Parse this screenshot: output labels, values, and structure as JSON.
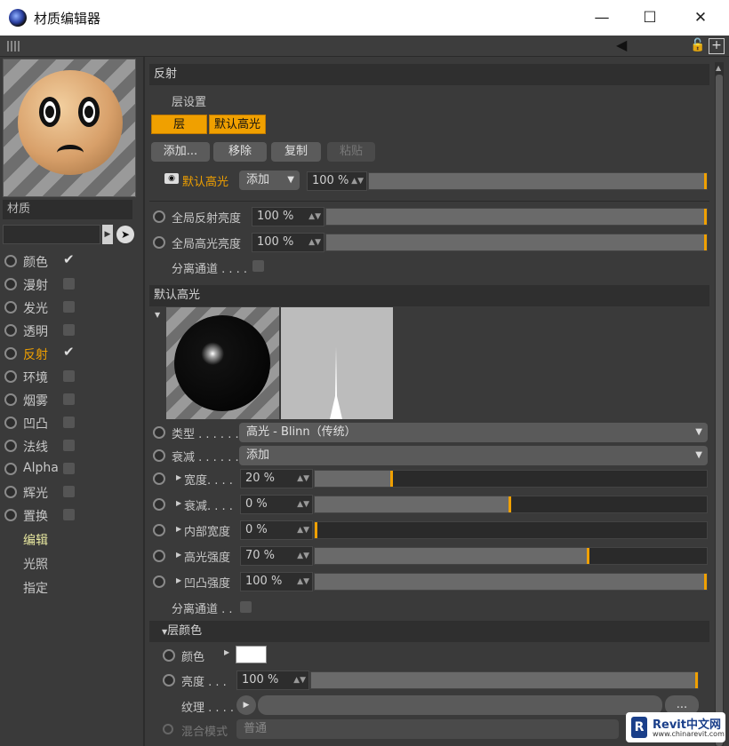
{
  "window": {
    "title": "材质编辑器",
    "minimize": "—",
    "maximize": "☐",
    "close": "✕"
  },
  "left": {
    "material_label": "材质",
    "channels": [
      {
        "label": "颜色",
        "checked": true,
        "active": false
      },
      {
        "label": "漫射",
        "checked": false,
        "active": false
      },
      {
        "label": "发光",
        "checked": false,
        "active": false
      },
      {
        "label": "透明",
        "checked": false,
        "active": false
      },
      {
        "label": "反射",
        "checked": true,
        "active": true
      },
      {
        "label": "环境",
        "checked": false,
        "active": false
      },
      {
        "label": "烟雾",
        "checked": false,
        "active": false
      },
      {
        "label": "凹凸",
        "checked": false,
        "active": false
      },
      {
        "label": "法线",
        "checked": false,
        "active": false
      },
      {
        "label": "Alpha",
        "checked": false,
        "active": false
      },
      {
        "label": "辉光",
        "checked": false,
        "active": false
      },
      {
        "label": "置换",
        "checked": false,
        "active": false
      }
    ],
    "links": [
      "编辑",
      "光照",
      "指定"
    ]
  },
  "reflect": {
    "header": "反射",
    "layer_settings": "层设置",
    "tab_layer": "层",
    "tab_default": "默认高光",
    "btn_add": "添加...",
    "btn_remove": "移除",
    "btn_copy": "复制",
    "btn_paste": "粘贴",
    "layer_name": "默认高光",
    "blend_mode": "添加",
    "layer_value": "100 %",
    "layer_fraction": 1.0,
    "global_reflect_label": "全局反射亮度",
    "global_reflect_value": "100 %",
    "global_reflect_fraction": 1.0,
    "global_spec_label": "全局高光亮度",
    "global_spec_value": "100 %",
    "global_spec_fraction": 1.0,
    "separate_label": "分离通道 . . . ."
  },
  "spec": {
    "header": "默认高光",
    "type_label": "类型 . . . . . .",
    "type_value": "高光 - Blinn（传统）",
    "atten_label": "衰减 . . . . . .",
    "atten_value": "添加",
    "params": [
      {
        "label": "宽度. . . .",
        "value": "20 %",
        "fraction": 0.2
      },
      {
        "label": "衰减. . . .",
        "value": "0 %",
        "fraction": 0.5
      },
      {
        "label": "内部宽度",
        "value": "0 %",
        "fraction": 0.0
      },
      {
        "label": "高光强度",
        "value": "70 %",
        "fraction": 0.7
      },
      {
        "label": "凹凸强度",
        "value": "100 %",
        "fraction": 1.0
      }
    ],
    "separate_label": "分离通道 . ."
  },
  "layer_color": {
    "header": "层颜色",
    "color_label": "颜色",
    "color_value": "#ffffff",
    "bright_label": "亮度 . . .",
    "bright_value": "100 %",
    "bright_fraction": 1.0,
    "texture_label": "纹理 . . . .",
    "texture_button": "...",
    "blend_label": "混合模式",
    "blend_value": "普通"
  },
  "watermark": {
    "brand": "Revit中文网",
    "url": "www.chinarevit.com"
  },
  "colors": {
    "accent": "#f0a000"
  }
}
